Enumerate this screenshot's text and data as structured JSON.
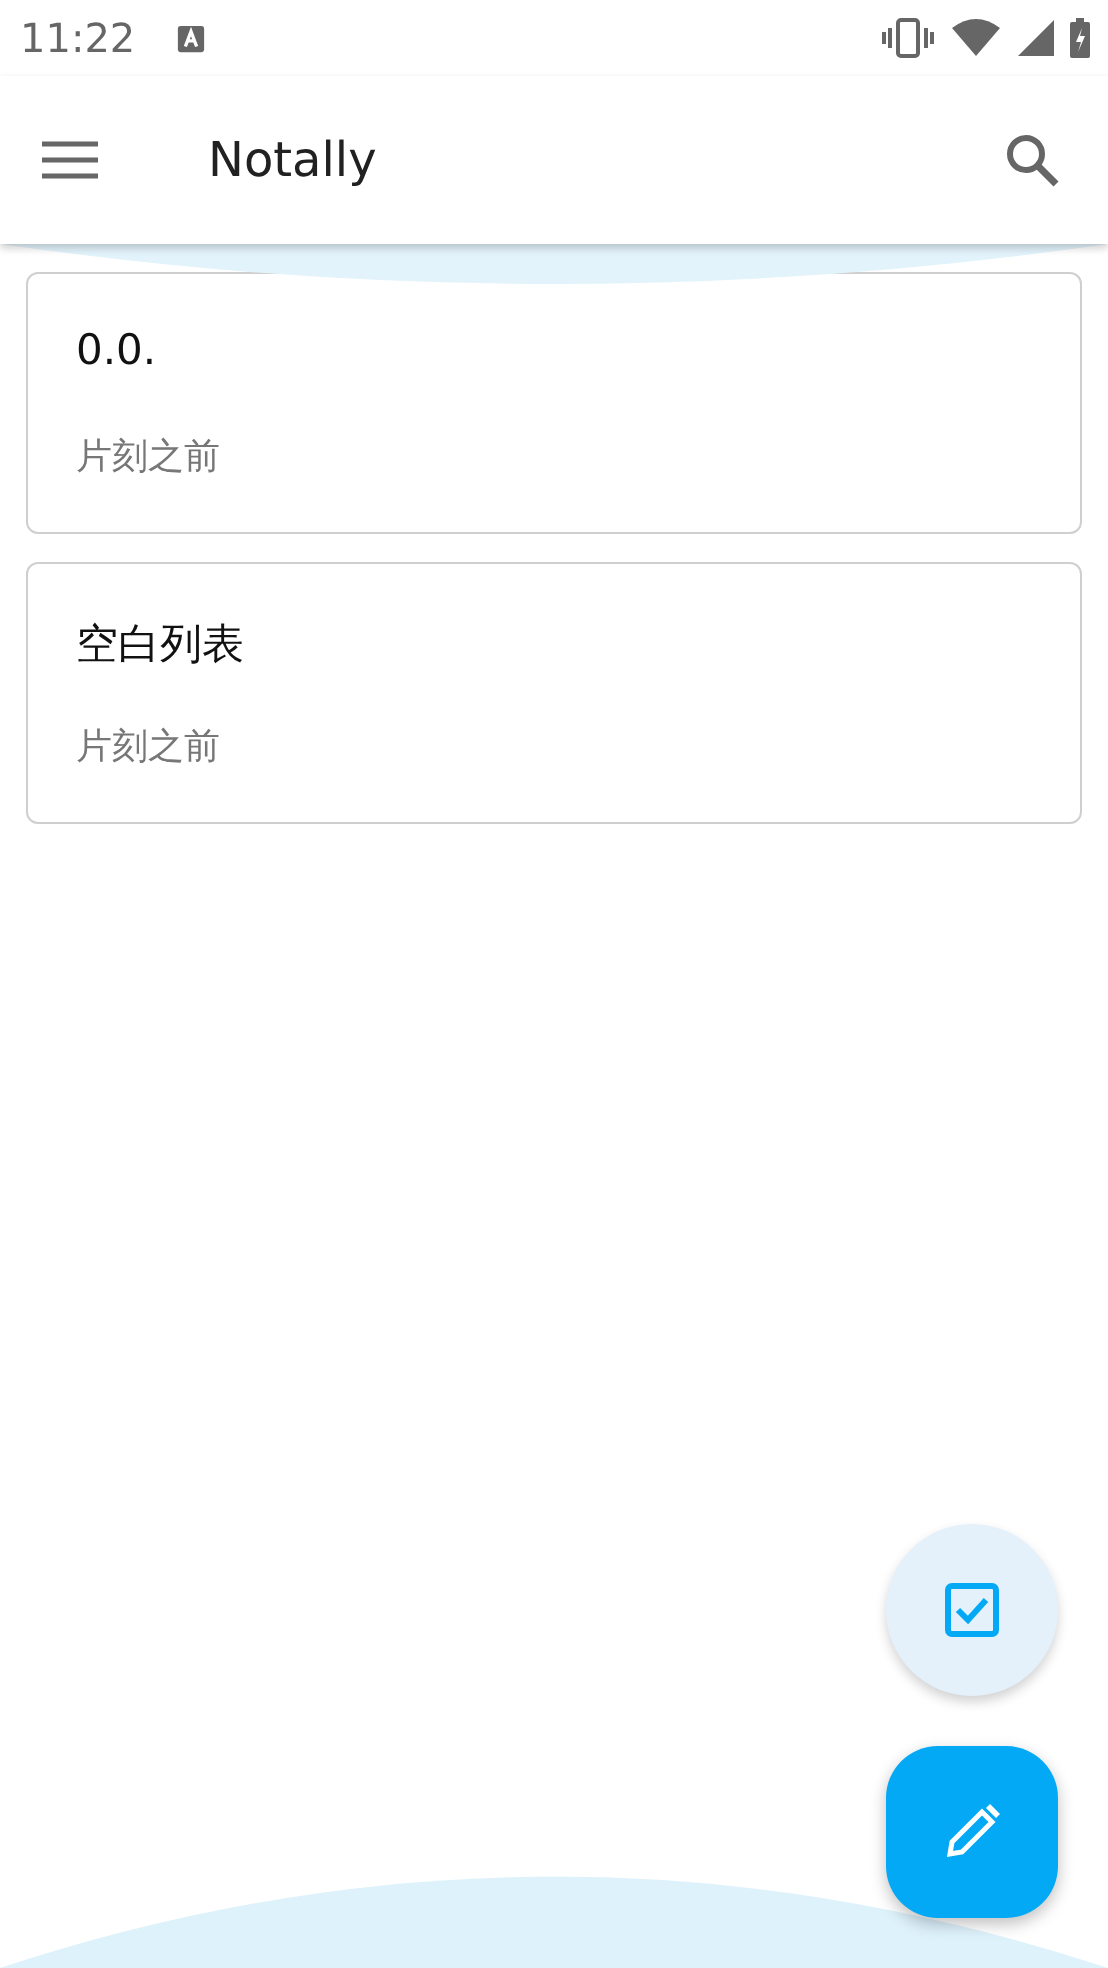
{
  "status_bar": {
    "time": "11:22"
  },
  "toolbar": {
    "title": "Notally"
  },
  "notes": [
    {
      "title": "0.0.",
      "time": "片刻之前"
    },
    {
      "title": "空白列表",
      "time": "片刻之前"
    }
  ]
}
